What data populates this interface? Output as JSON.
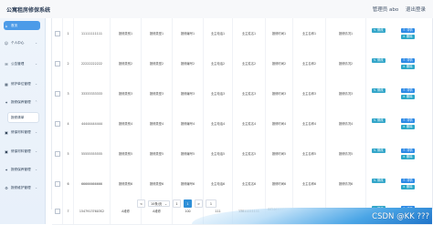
{
  "header": {
    "title": "公寓租房修保系统",
    "admin_label": "管理员 abo",
    "logout_label": "退出登录"
  },
  "sidebar": {
    "items": [
      {
        "label": "首页",
        "icon": "home-icon"
      },
      {
        "label": "个人中心",
        "icon": "user-icon"
      },
      {
        "label": "公告管理",
        "icon": "notice-icon"
      },
      {
        "label": "修护单位管理",
        "icon": "building-icon"
      },
      {
        "label": "报修保养管理",
        "icon": "wrench-icon"
      },
      {
        "label": "报修清单",
        "icon": ""
      },
      {
        "label": "修保材料管理",
        "icon": "box-icon"
      },
      {
        "label": "修保材料管理",
        "icon": "box-icon"
      },
      {
        "label": "报修保养管理",
        "icon": "wrench-icon"
      },
      {
        "label": "报修维护管理",
        "icon": "tools-icon"
      }
    ]
  },
  "table": {
    "rows": [
      {
        "no": "1",
        "c1": "11111111111",
        "c2": "报修类别1",
        "c3": "报修类型1",
        "c4": "报修编号1",
        "c5": "业主电话1",
        "c6": "业主姓名1",
        "c7": "报修时间1",
        "c8": "业主名称1",
        "c9": "报修情况1"
      },
      {
        "no": "2",
        "c1": "22222222222",
        "c2": "报修类别2",
        "c3": "报修类型2",
        "c4": "报修编号2",
        "c5": "业主电话2",
        "c6": "业主姓名2",
        "c7": "报修时间2",
        "c8": "业主名称2",
        "c9": "报修情况2"
      },
      {
        "no": "3",
        "c1": "33333333333",
        "c2": "报修类别3",
        "c3": "报修类型3",
        "c4": "报修编号3",
        "c5": "业主电话3",
        "c6": "业主姓名3",
        "c7": "报修时间3",
        "c8": "业主名称3",
        "c9": "报修情况3"
      },
      {
        "no": "4",
        "c1": "44444444444",
        "c2": "报修类别4",
        "c3": "报修类型4",
        "c4": "报修编号4",
        "c5": "业主电话4",
        "c6": "业主姓名4",
        "c7": "报修时间4",
        "c8": "业主名称4",
        "c9": "报修情况4"
      },
      {
        "no": "5",
        "c1": "55555555555",
        "c2": "报修类别5",
        "c3": "报修类型5",
        "c4": "报修编号5",
        "c5": "业主电话5",
        "c6": "业主姓名5",
        "c7": "报修时间5",
        "c8": "业主名称5",
        "c9": "报修情况5"
      },
      {
        "no": "6",
        "c1": "66666666666",
        "c2": "报修类别6",
        "c3": "报修类型6",
        "c4": "报修编号6",
        "c5": "业主电话6",
        "c6": "业主姓名6",
        "c7": "报修时间6",
        "c8": "业主名称6",
        "c9": "报修情况6"
      },
      {
        "no": "7",
        "c1": "15479137603S2",
        "c2": "A维修",
        "c3": "A维修",
        "c4": "100",
        "c5": "111",
        "c6": "13811111111",
        "c7": "4414633333333333",
        "c8": "业主名称",
        "c9": "报修情况"
      }
    ],
    "actions": {
      "edit": "修改",
      "detail": "详情",
      "delete": "删除"
    }
  },
  "pager": {
    "prev": "<",
    "page_size": "10条/页",
    "pages": [
      "1"
    ],
    "current": "1",
    "next": ">",
    "jump_value": "1"
  },
  "watermark": "CSDN @KK ???",
  "colors": {
    "accent": "#4c9be8",
    "edit_button": "#33a6c9",
    "detail_button": "#2c8ae6"
  }
}
